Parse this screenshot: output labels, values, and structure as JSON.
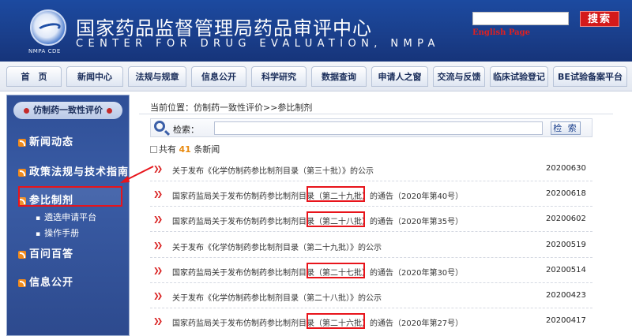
{
  "header": {
    "title_cn": "国家药品监督管理局药品审评中心",
    "title_en": "CENTER FOR DRUG EVALUATION, NMPA",
    "logo_caption": "NMPA CDE",
    "search_button": "搜索",
    "english_link": "English Page"
  },
  "nav": [
    "首　页",
    "新闻中心",
    "法规与规章",
    "信息公开",
    "科学研究",
    "数据查询",
    "申请人之窗",
    "交流与反馈",
    "临床试验登记",
    "BE试验备案平台"
  ],
  "sidebar": {
    "header": "仿制药一致性评价",
    "items": [
      "新闻动态",
      "政策法规与技术指南",
      "参比制剂",
      "百问百答",
      "信息公开"
    ],
    "sub_items": [
      "遴选申请平台",
      "操作手册"
    ]
  },
  "breadcrumb": "当前位置：仿制药一致性评价>>参比制剂",
  "search": {
    "label": "检索：",
    "button": "检 索"
  },
  "total": {
    "prefix": "共有",
    "count": "41",
    "suffix": "条新闻"
  },
  "news": [
    {
      "title": "关于发布《化学仿制药参比制剂目录（第三十批）》的公示",
      "date": "20200630"
    },
    {
      "title": "国家药监局关于发布仿制药参比制剂目录（第二十九批）的通告（2020年第40号）",
      "date": "20200618"
    },
    {
      "title": "国家药监局关于发布仿制药参比制剂目录（第二十八批）的通告（2020年第35号）",
      "date": "20200602"
    },
    {
      "title": "关于发布《化学仿制药参比制剂目录（第二十九批）》的公示",
      "date": "20200519"
    },
    {
      "title": "国家药监局关于发布仿制药参比制剂目录（第二十七批）的通告（2020年第30号）",
      "date": "20200514"
    },
    {
      "title": "关于发布《化学仿制药参比制剂目录（第二十八批）》的公示",
      "date": "20200423"
    },
    {
      "title": "国家药监局关于发布仿制药参比制剂目录（第二十六批）的通告（2020年第27号）",
      "date": "20200417"
    }
  ],
  "colors": {
    "header_blue": "#1a3f8c",
    "accent_red": "#d41a1a",
    "highlight_red": "#e8141b"
  }
}
